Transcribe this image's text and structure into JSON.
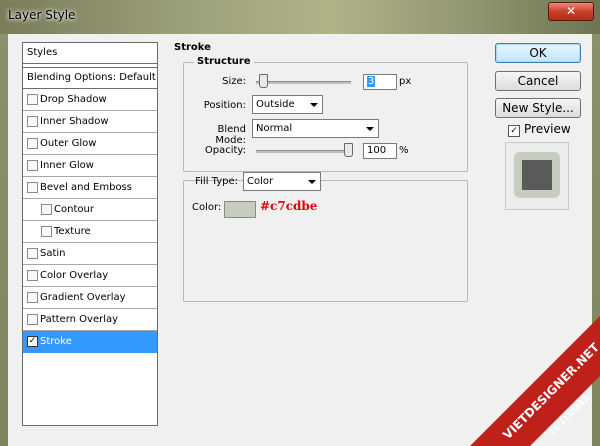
{
  "window": {
    "title": "Layer Style",
    "close_icon": "close-icon",
    "close_glyph": "✕"
  },
  "styles_panel": {
    "header": "Styles",
    "blending_options": "Blending Options: Default",
    "items": [
      {
        "label": "Drop Shadow",
        "checked": false,
        "sub": false
      },
      {
        "label": "Inner Shadow",
        "checked": false,
        "sub": false
      },
      {
        "label": "Outer Glow",
        "checked": false,
        "sub": false
      },
      {
        "label": "Inner Glow",
        "checked": false,
        "sub": false
      },
      {
        "label": "Bevel and Emboss",
        "checked": false,
        "sub": false
      },
      {
        "label": "Contour",
        "checked": false,
        "sub": true
      },
      {
        "label": "Texture",
        "checked": false,
        "sub": true
      },
      {
        "label": "Satin",
        "checked": false,
        "sub": false
      },
      {
        "label": "Color Overlay",
        "checked": false,
        "sub": false
      },
      {
        "label": "Gradient Overlay",
        "checked": false,
        "sub": false
      },
      {
        "label": "Pattern Overlay",
        "checked": false,
        "sub": false
      },
      {
        "label": "Stroke",
        "checked": true,
        "sub": false,
        "active": true
      }
    ]
  },
  "stroke": {
    "title": "Stroke",
    "structure": {
      "title": "Structure",
      "size_label": "Size:",
      "size_value": "3",
      "size_unit": "px",
      "size_level": 0.03,
      "position_label": "Position:",
      "position_value": "Outside",
      "blend_mode_label": "Blend Mode:",
      "blend_mode_value": "Normal",
      "opacity_label": "Opacity:",
      "opacity_value": "100",
      "opacity_unit": "%",
      "opacity_level": 1.0
    },
    "fill": {
      "fill_type_label": "Fill Type:",
      "fill_type_value": "Color",
      "color_label": "Color:",
      "color_hex": "#c7cdbe",
      "annotation": "#c7cdbe"
    }
  },
  "buttons": {
    "ok": "OK",
    "cancel": "Cancel",
    "new_style": "New Style...",
    "preview_label": "Preview",
    "preview_checked": true
  },
  "watermark": {
    "line1": "VIETDESIGNER.NET",
    "line2": "TUTORIAL"
  },
  "colors": {
    "accent_selection": "#3399ff",
    "annotation_red": "#e00000",
    "stroke_color": "#c7cdbe"
  }
}
